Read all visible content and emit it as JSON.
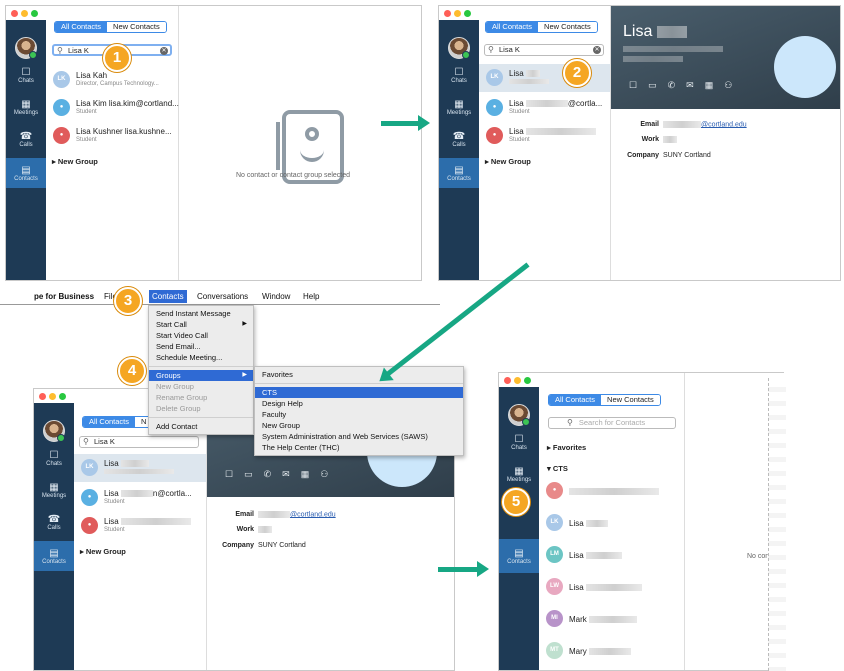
{
  "panel1": {
    "tabs": [
      "All Contacts",
      "New Contacts"
    ],
    "search_value": "Lisa K",
    "contacts": [
      {
        "initials": "LK",
        "color": "#a9c8e8",
        "name": "Lisa Kah",
        "sub": "Director, Campus Technology..."
      },
      {
        "initials": "",
        "color": "#5ab0e2",
        "name": "Lisa Kim lisa.kim@cortland...",
        "sub": "Student"
      },
      {
        "initials": "",
        "color": "#e05b5b",
        "name": "Lisa Kushner lisa.kushne...",
        "sub": "Student"
      }
    ],
    "new_group": "New Group",
    "empty_message": "No contact or contact group selected"
  },
  "sidebar": [
    {
      "icon": "☐",
      "label": "Chats"
    },
    {
      "icon": "▦",
      "label": "Meetings"
    },
    {
      "icon": "☎",
      "label": "Calls"
    },
    {
      "icon": "▤",
      "label": "Contacts"
    }
  ],
  "panel2": {
    "tabs": [
      "All Contacts",
      "New Contacts"
    ],
    "search_value": "Lisa K",
    "contacts": [
      {
        "name": "Lisa",
        "sub": ""
      },
      {
        "name": "Lisa",
        "tail": "@cortla...",
        "sub": "Student"
      },
      {
        "name": "Lisa",
        "sub": "Student"
      }
    ],
    "new_group": "New Group",
    "profile_name": "Lisa",
    "email_label": "Email",
    "email_value": "@cortland.edu",
    "work_label": "Work",
    "company_label": "Company",
    "company_value": "SUNY Cortland"
  },
  "menubar": {
    "items": [
      "pe for Business",
      "File",
      "Contacts",
      "Conversations",
      "Window",
      "Help"
    ]
  },
  "contacts_menu": {
    "items": [
      "Send Instant Message",
      "Start Call",
      "Start Video Call",
      "Send Email...",
      "Schedule Meeting...",
      "Groups",
      "New Group",
      "Rename Group",
      "Delete Group",
      "Add Contact"
    ]
  },
  "groups_menu": {
    "items": [
      "Favorites",
      "CTS",
      "Design Help",
      "Faculty",
      "New Group",
      "System Administration and Web Services (SAWS)",
      "The Help Center (THC)"
    ]
  },
  "panel3": {
    "tab_all": "All Contacts",
    "tab_new_partial": "N",
    "search_value": "Lisa K",
    "contacts": [
      {
        "name": "Lisa",
        "sub": ""
      },
      {
        "name": "Lisa",
        "tail": "n@cortla...",
        "sub": "Student"
      },
      {
        "name": "Lisa",
        "sub": "Student"
      }
    ],
    "new_group": "New Group",
    "email_label": "Email",
    "email_value": "@cortland.edu",
    "work_label": "Work",
    "company_label": "Company",
    "company_value": "SUNY Cortland"
  },
  "panel4": {
    "tabs": [
      "All Contacts",
      "New Contacts"
    ],
    "search_placeholder": "Search for Contacts",
    "favorites": "Favorites",
    "cts": "CTS",
    "members": [
      {
        "initials": "",
        "color": "#e88a8a",
        "name": ""
      },
      {
        "initials": "LK",
        "color": "#a9c8e8",
        "name": "Lisa"
      },
      {
        "initials": "LM",
        "color": "#6cc5c4",
        "name": "Lisa"
      },
      {
        "initials": "LW",
        "color": "#e8a8c0",
        "name": "Lisa"
      },
      {
        "initials": "MI",
        "color": "#b893c9",
        "name": "Mark"
      },
      {
        "initials": "MT",
        "color": "#bfe0cf",
        "name": "Mary"
      }
    ],
    "no_contact_partial": "No cont"
  },
  "steps": [
    "1",
    "2",
    "3",
    "4",
    "5"
  ]
}
